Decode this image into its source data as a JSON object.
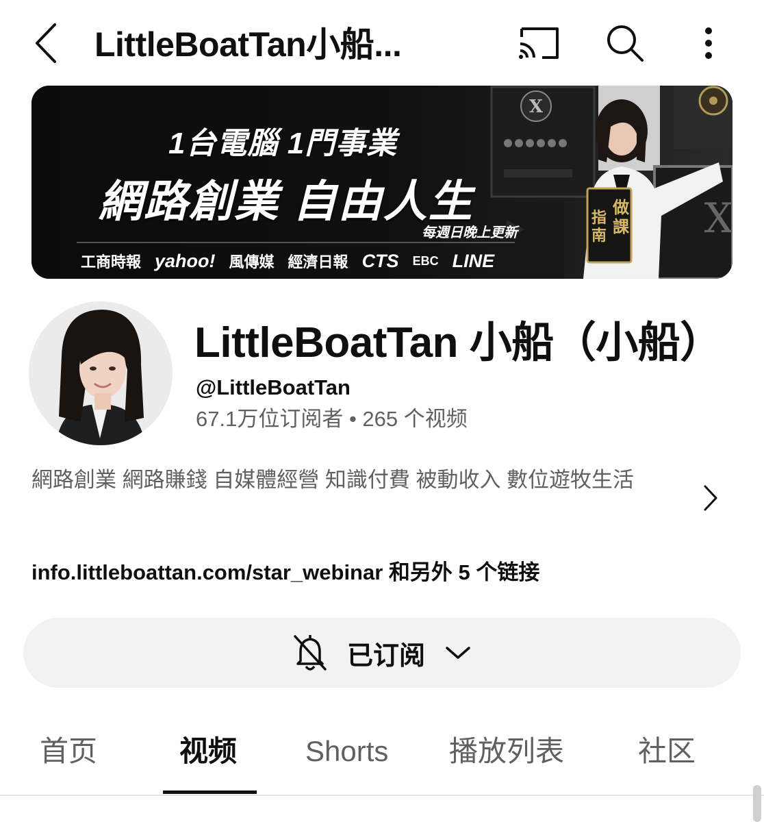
{
  "topbar": {
    "title": "LittleBoatTan小船..."
  },
  "banner": {
    "line1": "1台電腦 1門事業",
    "line2": "網路創業 自由人生",
    "line3": "每週日晚上更新",
    "book_text": "做課指南",
    "logos": [
      "工商時報",
      "yahoo!",
      "風傳媒",
      "經濟日報",
      "CTS",
      "EBC",
      "LINE"
    ]
  },
  "channel": {
    "name": "LittleBoatTan 小船（小船）",
    "handle": "@LittleBoatTan",
    "stats": "67.1万位订阅者 • 265 个视频",
    "description": "網路創業 網路賺錢 自媒體經營  知識付費 被動收入 數位遊牧生活",
    "links": "info.littleboattan.com/star_webinar 和另外 5 个链接"
  },
  "subscribe": {
    "label": "已订阅"
  },
  "tabs": [
    {
      "label": "首页"
    },
    {
      "label": "视频"
    },
    {
      "label": "Shorts"
    },
    {
      "label": "播放列表"
    },
    {
      "label": "社区"
    }
  ],
  "active_tab": "视频",
  "colors": {
    "primary_text": "#0f0f0f",
    "secondary_text": "#606060",
    "button_bg": "#f2f2f2",
    "banner_bg": "#0b0b0b"
  }
}
